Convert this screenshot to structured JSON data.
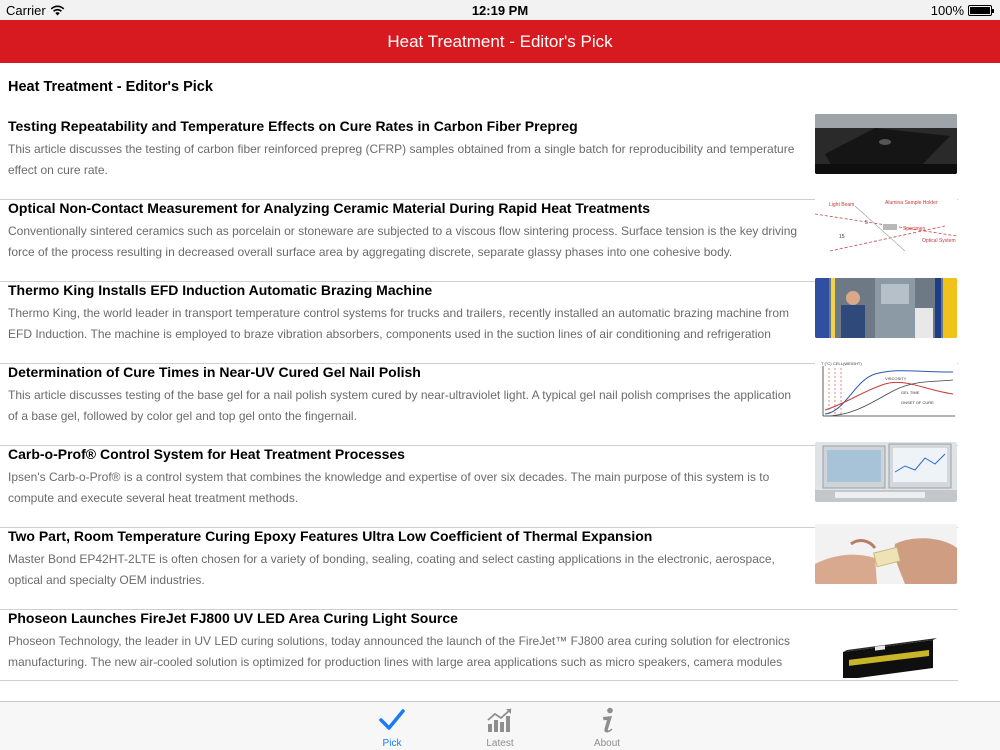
{
  "status": {
    "carrier": "Carrier",
    "time": "12:19 PM",
    "battery": "100%",
    "battery_level": 1.0
  },
  "nav": {
    "title": "Heat Treatment - Editor's Pick"
  },
  "section": {
    "title": "Heat Treatment - Editor's Pick"
  },
  "articles": [
    {
      "title": "Testing Repeatability and Temperature Effects on Cure Rates in Carbon Fiber Prepreg",
      "description": "This article discusses the testing of carbon fiber reinforced prepreg (CFRP) samples obtained from a single batch for reproducibility and temperature effect on cure rate."
    },
    {
      "title": "Optical Non-Contact Measurement for Analyzing Ceramic Material During Rapid Heat Treatments",
      "description": "Conventionally sintered ceramics such as porcelain or stoneware are subjected to a viscous flow sintering process. Surface tension is the key driving force of the process resulting in decreased overall surface area by aggregating discrete, separate glassy phases into one cohesive body."
    },
    {
      "title": "Thermo King Installs EFD Induction Automatic Brazing Machine",
      "description": "Thermo King, the world leader in transport temperature control systems for trucks and trailers, recently installed an automatic brazing machine from EFD Induction. The machine is employed to braze vibration absorbers, components used in the suction lines of air conditioning and refrigeration"
    },
    {
      "title": "Determination of Cure Times in Near-UV Cured Gel Nail Polish",
      "description": "This article discusses testing of the base gel for a nail polish system cured by near-ultraviolet light. A typical gel nail polish comprises the application of a base gel, followed by color gel and top gel onto the fingernail."
    },
    {
      "title": "Carb-o-Prof® Control System for Heat Treatment Processes",
      "description": "Ipsen's Carb-o-Prof® is a control system that combines the knowledge and expertise of over six decades. The main purpose of this system is to compute and execute several heat treatment methods."
    },
    {
      "title": "Two Part, Room Temperature Curing Epoxy Features Ultra Low Coefficient of Thermal Expansion",
      "description": "Master Bond EP42HT-2LTE is often chosen for a variety of bonding, sealing, coating and select casting applications in the electronic, aerospace, optical and specialty OEM industries."
    },
    {
      "title": "Phoseon Launches FireJet FJ800 UV LED Area Curing Light Source",
      "description": "Phoseon Technology, the leader in UV LED curing solutions, today announced the launch of the FireJet™ FJ800 area curing solution for electronics manufacturing. The new air-cooled solution is optimized for production lines with large area applications such as micro speakers, camera modules and"
    }
  ],
  "thumb_labels": {
    "ceramic": [
      "Light Beam",
      "Alumina Sample Holder",
      "Specimen",
      "Optical System",
      "15",
      "5"
    ],
    "cure": [
      "T (°C)",
      "CELL(WEIGHT)",
      "VISCOSITY",
      "GEL TIME",
      "ONSET OF CURE"
    ]
  },
  "tabs": [
    {
      "label": "Pick",
      "icon": "checkmark-icon",
      "active": true
    },
    {
      "label": "Latest",
      "icon": "chart-icon",
      "active": false
    },
    {
      "label": "About",
      "icon": "info-icon",
      "active": false
    }
  ],
  "colors": {
    "nav": "#d71a1f",
    "tab_active": "#1a7cf5",
    "tab_inactive": "#8e8e8e"
  }
}
